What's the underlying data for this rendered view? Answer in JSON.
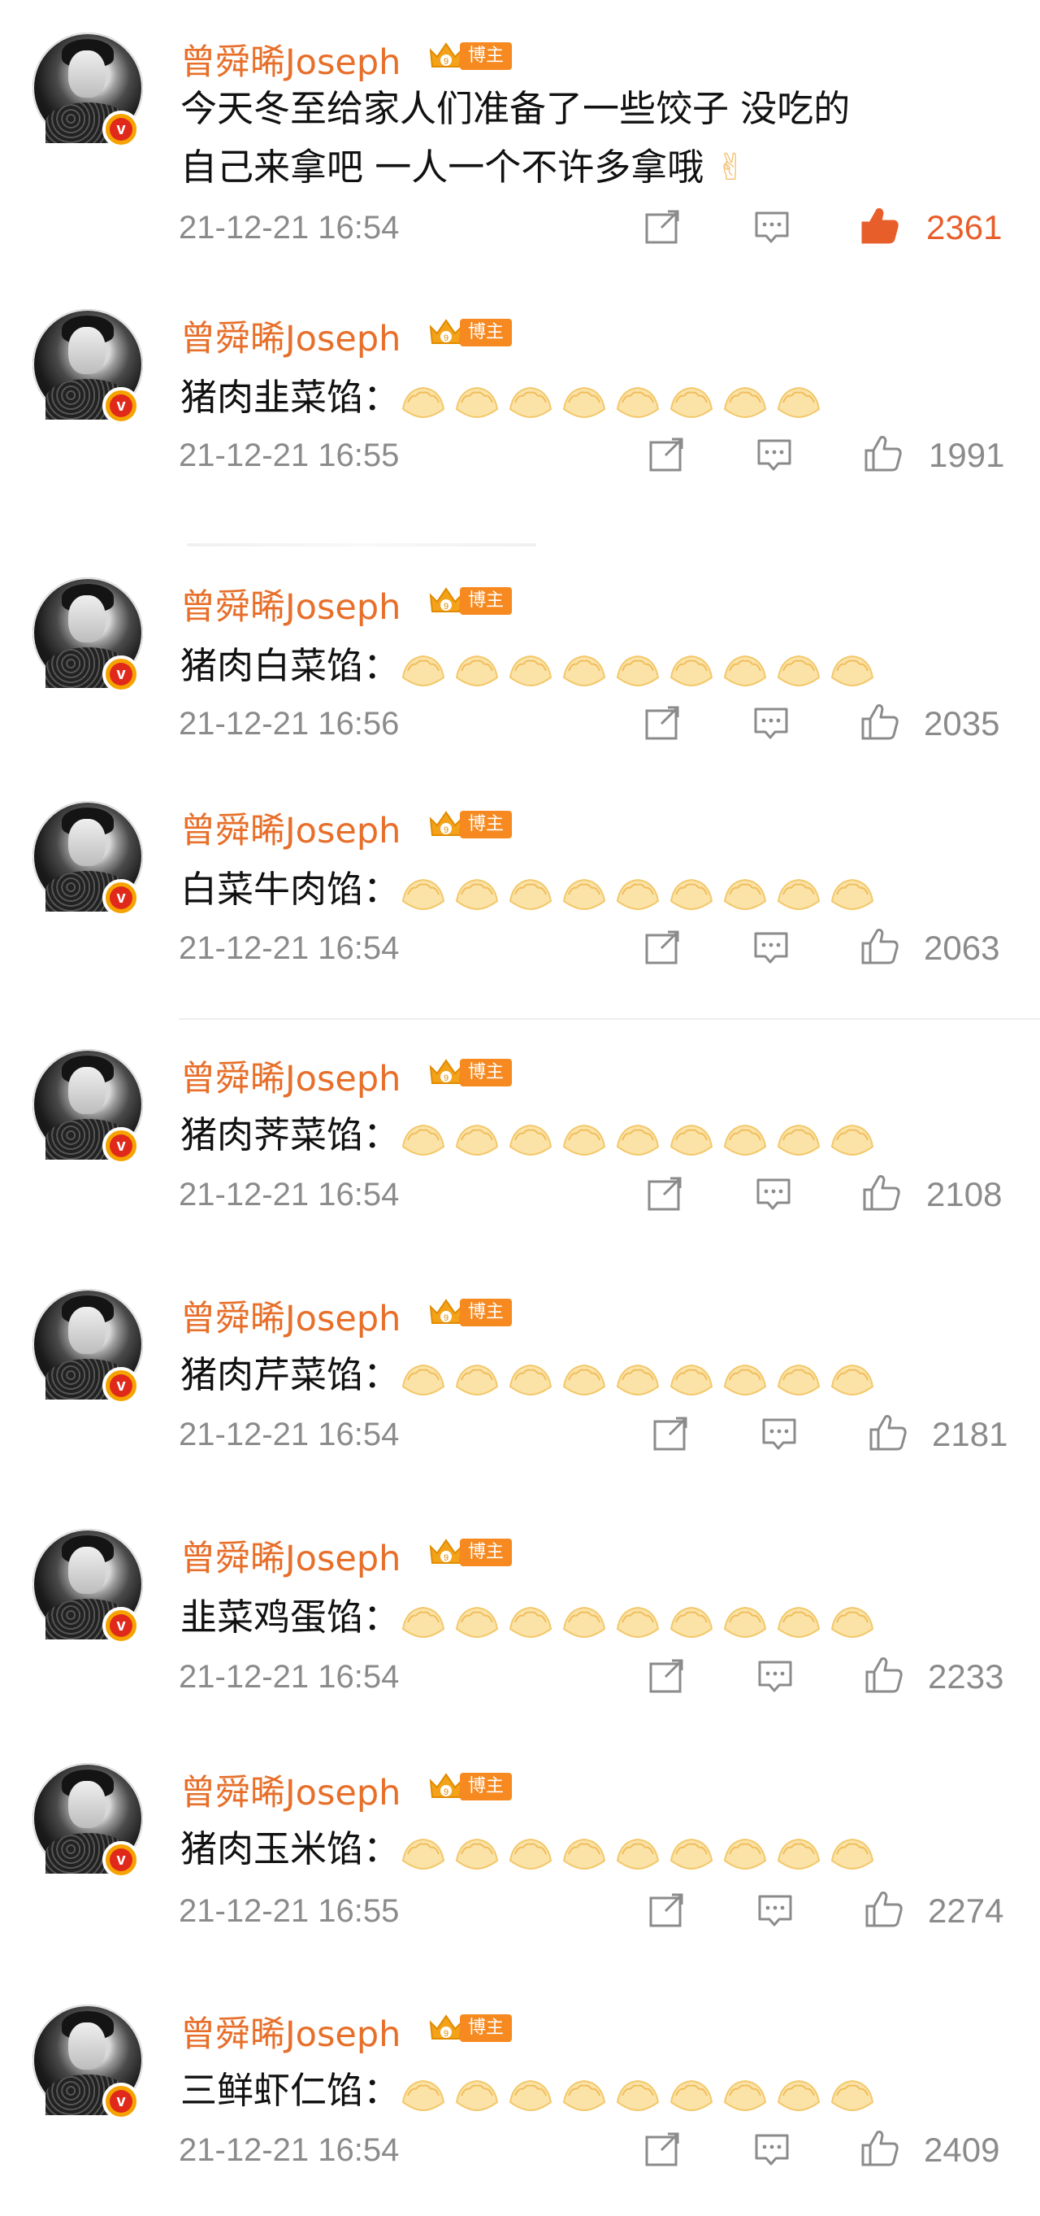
{
  "colors": {
    "name": "#e76f2a",
    "liked": "#e85e2b",
    "meta": "#8b8b8b",
    "badge": "#f6891f"
  },
  "icons": {
    "share": "share-icon",
    "comment": "comment-icon",
    "like": "thumbs-up-icon",
    "verified": "verified-v-icon",
    "crown": "vip-crown-icon",
    "dumpling": "dumpling-emoji",
    "victory": "victory-hand-emoji"
  },
  "badge_label": "博主",
  "posts": [
    {
      "name": "曾舜晞Joseph",
      "text_line1": "今天冬至给家人们准备了一些饺子 没吃的",
      "text_line2": "自己来拿吧  一人一个不许多拿哦",
      "time": "21-12-21 16:54",
      "likes": "2361",
      "liked": true
    },
    {
      "name": "曾舜晞Joseph",
      "label": "猪肉韭菜馅：",
      "dumplings": 8,
      "time": "21-12-21 16:55",
      "likes": "1991"
    },
    {
      "name": "曾舜晞Joseph",
      "label": "猪肉白菜馅：",
      "dumplings": 9,
      "time": "21-12-21 16:56",
      "likes": "2035"
    },
    {
      "name": "曾舜晞Joseph",
      "label": "白菜牛肉馅：",
      "dumplings": 9,
      "time": "21-12-21 16:54",
      "likes": "2063"
    },
    {
      "name": "曾舜晞Joseph",
      "label": "猪肉荠菜馅：",
      "dumplings": 9,
      "time": "21-12-21 16:54",
      "likes": "2108"
    },
    {
      "name": "曾舜晞Joseph",
      "label": "猪肉芹菜馅：",
      "dumplings": 9,
      "time": "21-12-21 16:54",
      "likes": "2181"
    },
    {
      "name": "曾舜晞Joseph",
      "label": "韭菜鸡蛋馅：",
      "dumplings": 9,
      "time": "21-12-21 16:54",
      "likes": "2233"
    },
    {
      "name": "曾舜晞Joseph",
      "label": "猪肉玉米馅：",
      "dumplings": 9,
      "time": "21-12-21 16:55",
      "likes": "2274"
    },
    {
      "name": "曾舜晞Joseph",
      "label": "三鲜虾仁馅：",
      "dumplings": 9,
      "time": "21-12-21 16:54",
      "likes": "2409"
    }
  ]
}
